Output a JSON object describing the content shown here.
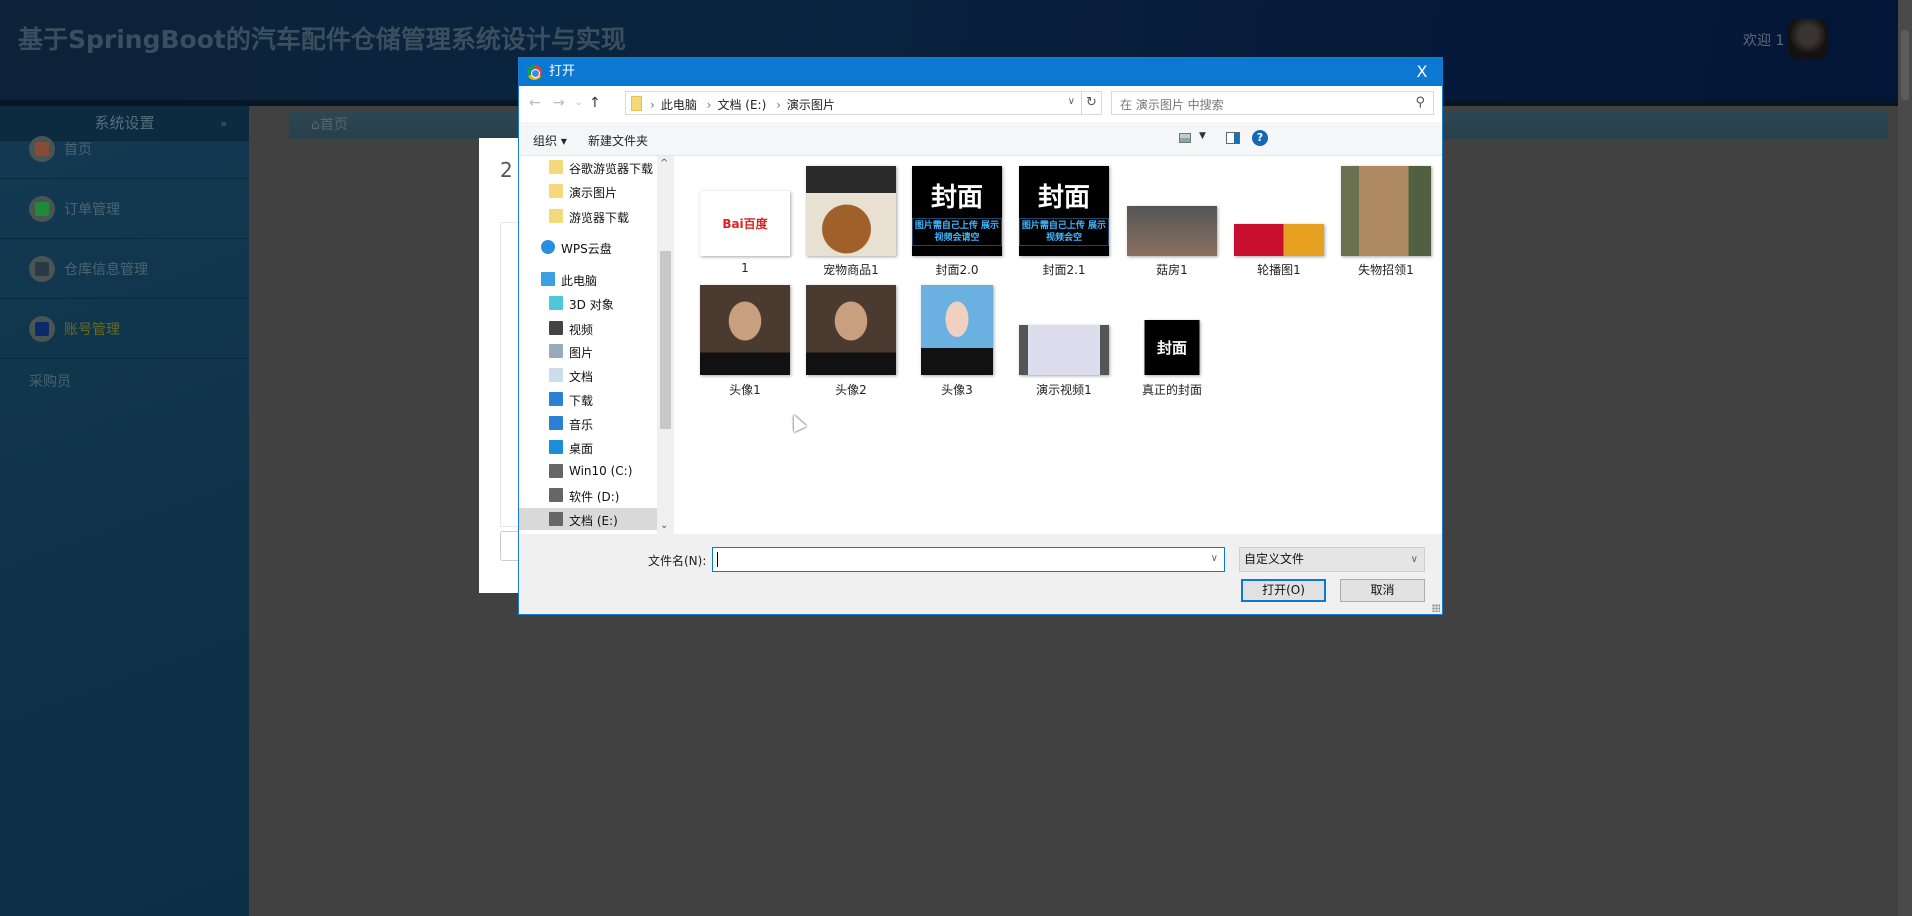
{
  "app": {
    "title": "基于SpringBoot的汽车配件仓储管理系统设计与实现",
    "welcome": "欢迎 1"
  },
  "sidebar": {
    "header": "系统设置",
    "collapse_icon": "double-chevron-down-icon",
    "items": [
      {
        "label": "首页",
        "icon": "home-icon",
        "color": "#8a4a3a"
      },
      {
        "label": "订单管理",
        "icon": "order-icon",
        "color": "#1e8a3a"
      },
      {
        "label": "仓库信息管理",
        "icon": "warehouse-icon",
        "color": "#2a3a44"
      },
      {
        "label": "账号管理",
        "icon": "user-icon",
        "color": "#0a2a6a",
        "active": true
      }
    ],
    "role": "采购员"
  },
  "breadcrumb": {
    "home": "首页"
  },
  "background_modal": {
    "number": "2"
  },
  "dialog": {
    "title": "打开",
    "close": "X",
    "path": [
      "此电脑",
      "文档 (E:)",
      "演示图片"
    ],
    "search_placeholder": "在 演示图片 中搜索",
    "toolbar": {
      "organize": "组织 ▾",
      "new_folder": "新建文件夹"
    },
    "nav": [
      {
        "label": "谷歌游览器下载",
        "icon": "folder-icon"
      },
      {
        "label": "演示图片",
        "icon": "folder-icon"
      },
      {
        "label": "游览器下载",
        "icon": "folder-icon"
      },
      {
        "label": "WPS云盘",
        "icon": "cloud-icon"
      },
      {
        "label": "此电脑",
        "icon": "computer-icon"
      },
      {
        "label": "3D 对象",
        "icon": "3d-objects-icon"
      },
      {
        "label": "视频",
        "icon": "video-icon"
      },
      {
        "label": "图片",
        "icon": "pictures-icon"
      },
      {
        "label": "文档",
        "icon": "documents-icon"
      },
      {
        "label": "下载",
        "icon": "download-icon"
      },
      {
        "label": "音乐",
        "icon": "music-icon"
      },
      {
        "label": "桌面",
        "icon": "desktop-icon"
      },
      {
        "label": "Win10 (C:)",
        "icon": "drive-icon"
      },
      {
        "label": "软件 (D:)",
        "icon": "drive-icon"
      },
      {
        "label": "文档 (E:)",
        "icon": "drive-icon",
        "selected": true
      }
    ],
    "files": [
      {
        "name": "1",
        "kind": "baidu"
      },
      {
        "name": "宠物商品1",
        "kind": "dogfood"
      },
      {
        "name": "封面2.0",
        "kind": "cover",
        "cover_title": "封面",
        "cover_lines": "图片需自己上传 展示视频会请空"
      },
      {
        "name": "封面2.1",
        "kind": "cover",
        "cover_title": "封面",
        "cover_lines": "图片需自己上传 展示视频会空"
      },
      {
        "name": "菇房1",
        "kind": "photo"
      },
      {
        "name": "轮播图1",
        "kind": "banner"
      },
      {
        "name": "失物招领1",
        "kind": "sign"
      },
      {
        "name": "头像1",
        "kind": "portrait"
      },
      {
        "name": "头像2",
        "kind": "portrait"
      },
      {
        "name": "头像3",
        "kind": "portrait-blue"
      },
      {
        "name": "演示视频1",
        "kind": "video"
      },
      {
        "name": "真正的封面",
        "kind": "cover-small",
        "cover_title": "封面"
      }
    ],
    "filename_label": "文件名(N):",
    "filename_value": "",
    "file_type": "自定义文件",
    "open_button": "打开(O)",
    "cancel_button": "取消",
    "accent": "#0b78d2"
  }
}
